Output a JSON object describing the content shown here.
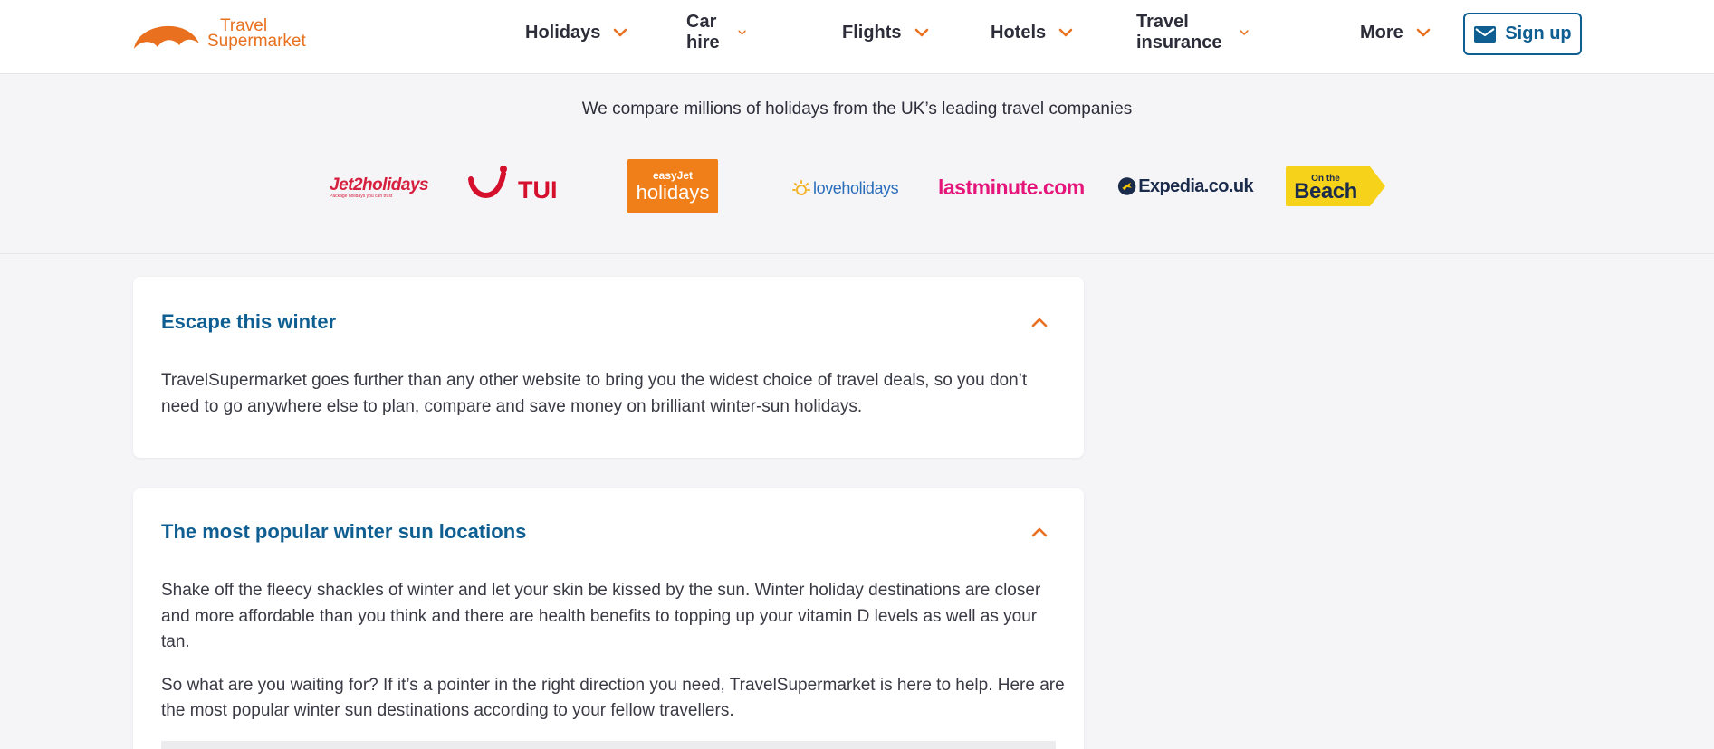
{
  "header": {
    "logo": {
      "line1": "Travel",
      "line2": "Supermarket",
      "icon": "sun-icon",
      "color": "#e8701e"
    },
    "nav": [
      {
        "label": "Holidays",
        "icon": "chevron-down-icon"
      },
      {
        "label": "Car hire",
        "icon": "chevron-down-icon"
      },
      {
        "label": "Flights",
        "icon": "chevron-down-icon"
      },
      {
        "label": "Hotels",
        "icon": "chevron-down-icon"
      },
      {
        "label": "Travel insurance",
        "icon": "chevron-down-icon"
      },
      {
        "label": "More",
        "icon": "chevron-down-icon"
      }
    ],
    "signup": {
      "label": "Sign up",
      "icon": "mail-icon",
      "color": "#0f5e91"
    }
  },
  "partners": {
    "title": "We compare millions of holidays from the UK’s leading travel companies",
    "logos": [
      {
        "name": "jet2holidays",
        "text": "Jet2holidays",
        "tagline": "Package holidays you can trust",
        "color": "#d6203f"
      },
      {
        "name": "TUI",
        "text": "TUI",
        "color": "#d4102c"
      },
      {
        "name": "easyJet holidays",
        "text_top": "easyJet",
        "text": "holidays",
        "color": "#f07f1a"
      },
      {
        "name": "loveholidays",
        "text": "loveholidays",
        "color": "#2a6ebb"
      },
      {
        "name": "lastminute.com",
        "text": "lastminute.com",
        "color": "#e5157a"
      },
      {
        "name": "Expedia.co.uk",
        "text": "Expedia.co.uk",
        "color": "#1b2b4b"
      },
      {
        "name": "On the Beach",
        "text_top": "On the",
        "text": "Beach",
        "color": "#f7d21b"
      }
    ]
  },
  "cards": [
    {
      "title": "Escape this winter",
      "icon": "chevron-up-icon",
      "paragraphs": [
        "TravelSupermarket goes further than any other website to bring you the widest choice of travel deals, so you don’t need to go anywhere else to plan, compare and save money on brilliant winter-sun holidays."
      ]
    },
    {
      "title": "The most popular winter sun locations",
      "icon": "chevron-up-icon",
      "paragraphs": [
        "Shake off the fleecy shackles of winter and let your skin be kissed by the sun. Winter holiday destinations are closer and more affordable than you think and there are health benefits to topping up your vitamin D levels as well as your tan.",
        "So what are you waiting for? If it’s a pointer in the right direction you need, TravelSupermarket is here to help. Here are the most popular winter sun destinations according to your fellow travellers."
      ]
    }
  ],
  "colors": {
    "accent": "#e8701e",
    "link": "#0f5e91",
    "page_bg": "#f5f5f7"
  }
}
